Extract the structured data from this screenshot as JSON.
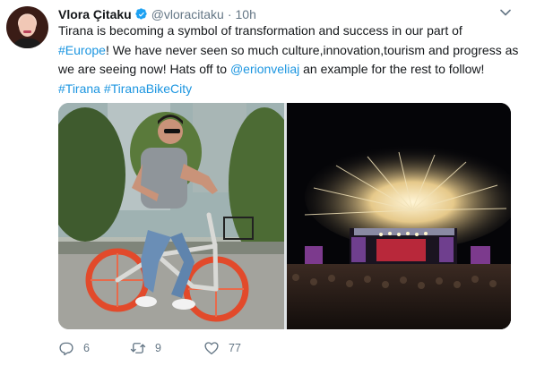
{
  "tweet": {
    "author_name": "Vlora Çitaku",
    "handle": "@vloracitaku",
    "separator": "·",
    "time": "10h",
    "text": {
      "l1": "Tirana is becoming a symbol of transformation and success in our part of",
      "l2_link": "#Europe",
      "l2_rest": "! We have never seen so much culture,innovation,tourism and progress as",
      "l3_pre": "we are seeing now! Hats off to ",
      "l3_mention": "@erionveliaj",
      "l3_post": " an example for the rest to follow!",
      "hashtag1": "#Tirana",
      "hashtag2": "#TiranaBikeCity"
    },
    "media": {
      "left_photo": "man-riding-orange-bike-photo",
      "right_photo": "fireworks-concert-photo"
    },
    "actions": {
      "reply_count": "6",
      "retweet_count": "9",
      "like_count": "77"
    },
    "colors": {
      "link": "#1b95e0",
      "text": "#14171a",
      "muted": "#657786",
      "verified": "#1da1f2"
    },
    "icons": [
      "verified-badge-icon",
      "chevron-down-icon",
      "reply-icon",
      "retweet-icon",
      "like-heart-icon"
    ]
  }
}
